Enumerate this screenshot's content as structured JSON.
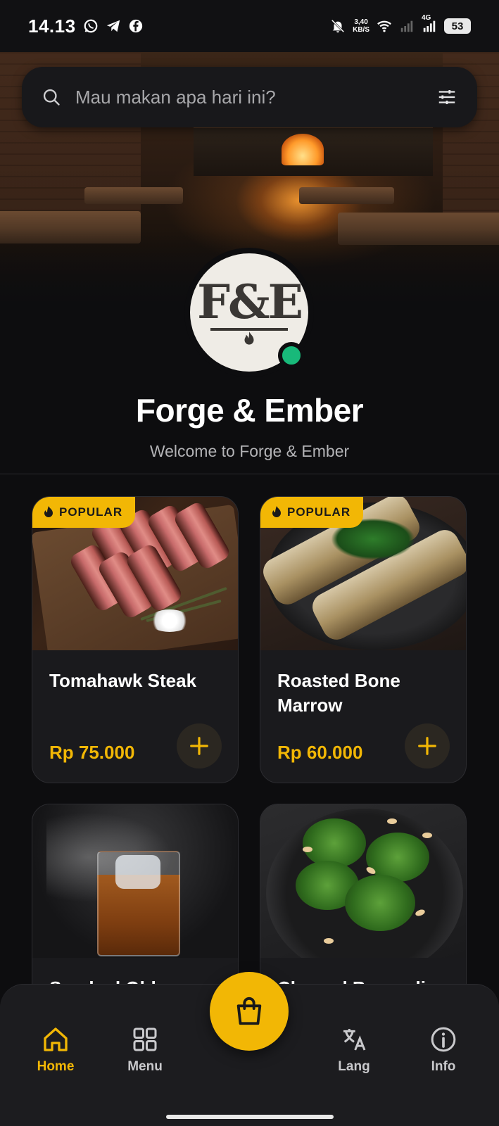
{
  "status_bar": {
    "time": "14.13",
    "net_speed_value": "3,40",
    "net_speed_unit": "KB/S",
    "network_type": "4G",
    "battery": "53"
  },
  "search": {
    "placeholder": "Mau makan apa hari ini?"
  },
  "restaurant": {
    "name": "Forge & Ember",
    "welcome": "Welcome to Forge & Ember",
    "logo_text": "F&E",
    "online": true
  },
  "menu_items": [
    {
      "badge": "POPULAR",
      "name": "Tomahawk Steak",
      "price": "Rp 75.000"
    },
    {
      "badge": "POPULAR",
      "name": "Roasted Bone Marrow",
      "price": "Rp 60.000"
    },
    {
      "badge": "",
      "name": "Smoked Old",
      "price": ""
    },
    {
      "badge": "",
      "name": "Charred Broccoli",
      "price": ""
    }
  ],
  "bottom_nav": {
    "items": [
      {
        "label": "Home",
        "icon": "home-icon",
        "active": true
      },
      {
        "label": "Menu",
        "icon": "grid-icon",
        "active": false
      },
      {
        "label": "Lang",
        "icon": "translate-icon",
        "active": false
      },
      {
        "label": "Info",
        "icon": "info-icon",
        "active": false
      }
    ],
    "fab_icon": "shopping-bag-icon"
  },
  "colors": {
    "accent": "#f2b705",
    "background": "#0d0d0f",
    "card": "#1a1a1d",
    "online": "#18b97a"
  }
}
